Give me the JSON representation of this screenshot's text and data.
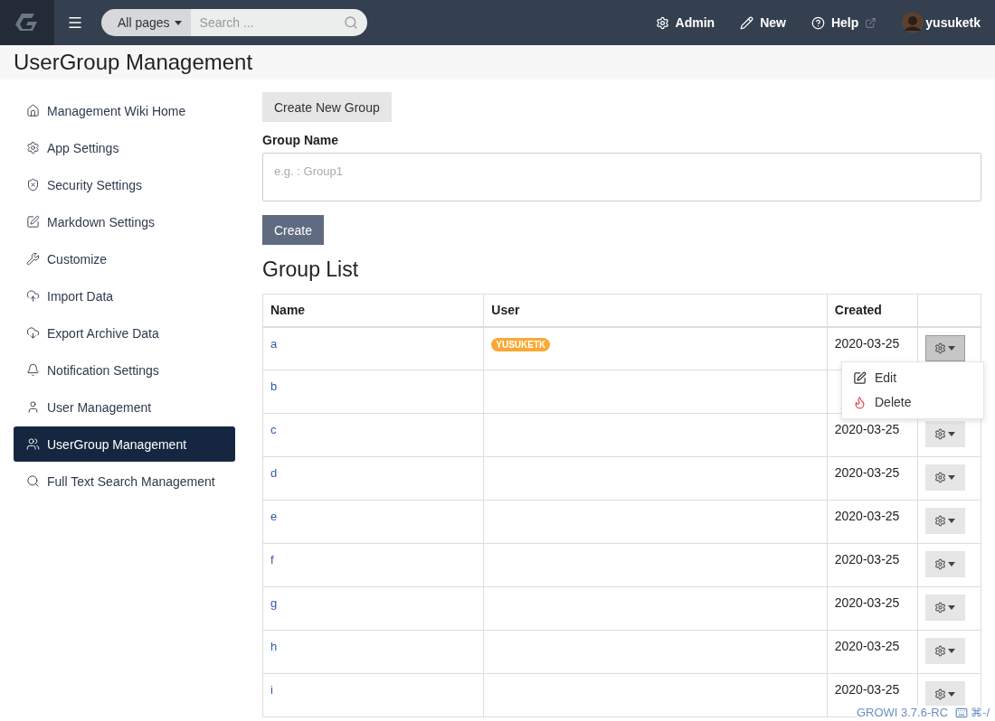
{
  "navbar": {
    "search_scope": "All pages",
    "search_placeholder": "Search ...",
    "links": [
      "Admin",
      "New",
      "Help"
    ],
    "user": "yusuketk"
  },
  "page_title": "UserGroup Management",
  "sidebar": {
    "items": [
      {
        "label": "Management Wiki Home",
        "selected": false
      },
      {
        "label": "App Settings",
        "selected": false
      },
      {
        "label": "Security Settings",
        "selected": false
      },
      {
        "label": "Markdown Settings",
        "selected": false
      },
      {
        "label": "Customize",
        "selected": false
      },
      {
        "label": "Import Data",
        "selected": false
      },
      {
        "label": "Export Archive Data",
        "selected": false
      },
      {
        "label": "Notification Settings",
        "selected": false
      },
      {
        "label": "User Management",
        "selected": false
      },
      {
        "label": "UserGroup Management",
        "selected": true
      },
      {
        "label": "Full Text Search Management",
        "selected": false
      }
    ]
  },
  "create_form": {
    "toggle_button": "Create New Group",
    "field_label": "Group Name",
    "placeholder": "e.g. : Group1",
    "submit": "Create"
  },
  "group_list": {
    "heading": "Group List",
    "columns": [
      "Name",
      "User",
      "Created"
    ],
    "rows": [
      {
        "name": "a",
        "users": [
          "YUSUKETK"
        ],
        "created": "2020-03-25",
        "menu_open": true
      },
      {
        "name": "b",
        "users": []
      },
      {
        "name": "c",
        "users": [],
        "created": "2020-03-25",
        "menu_open": false
      },
      {
        "name": "d",
        "users": [],
        "created": "2020-03-25",
        "menu_open": false
      },
      {
        "name": "e",
        "users": [],
        "created": "2020-03-25",
        "menu_open": false
      },
      {
        "name": "f",
        "users": [],
        "created": "2020-03-25",
        "menu_open": false
      },
      {
        "name": "g",
        "users": [],
        "created": "2020-03-25",
        "menu_open": false
      },
      {
        "name": "h",
        "users": [],
        "created": "2020-03-25",
        "menu_open": false
      },
      {
        "name": "i",
        "users": [],
        "created": "2020-03-25",
        "menu_open": false
      }
    ],
    "menu": [
      {
        "kind": "edit",
        "label": "Edit"
      },
      {
        "kind": "delete",
        "label": "Delete"
      }
    ]
  },
  "footer": {
    "version": "GROWI 3.7.6-RC",
    "shortcut": "⌘-/"
  }
}
